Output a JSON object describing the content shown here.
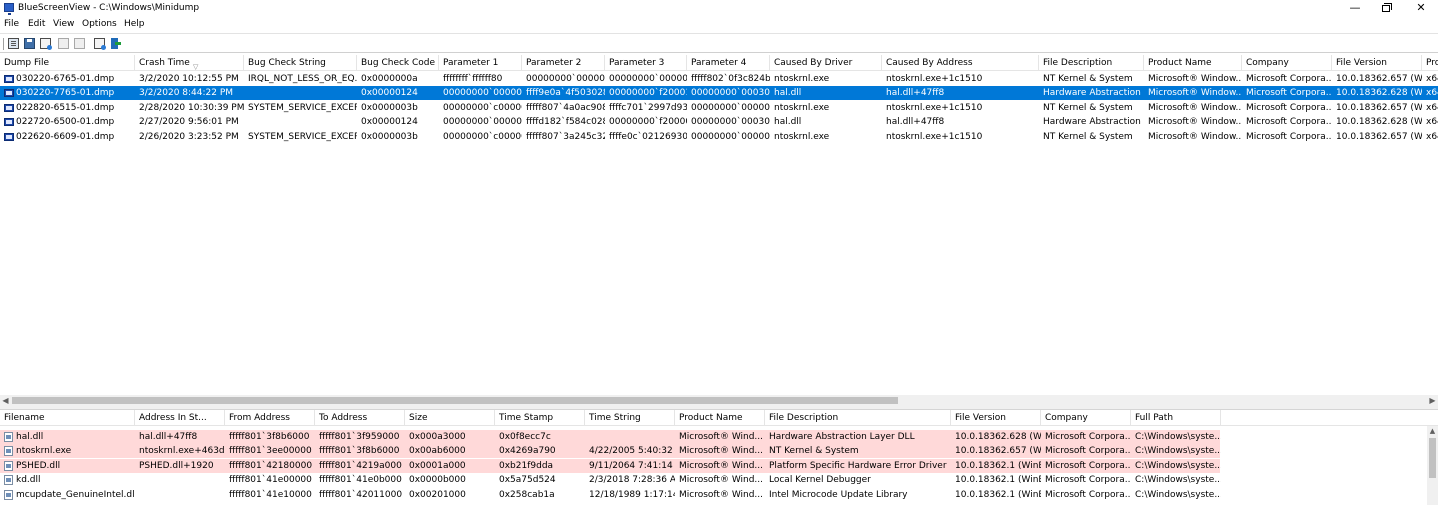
{
  "window": {
    "title": "BlueScreenView  -  C:\\Windows\\Minidump",
    "minimize_glyph": "—",
    "close_glyph": "✕"
  },
  "menu": [
    "File",
    "Edit",
    "View",
    "Options",
    "Help"
  ],
  "toolbar": {
    "icons": [
      "properties-icon",
      "save-icon",
      "html-report-icon",
      "copy-icon",
      "select-all-icon",
      "find-icon",
      "exit-icon"
    ]
  },
  "upper": {
    "sort_arrow": "▽",
    "columns": [
      "Dump File",
      "Crash Time",
      "Bug Check String",
      "Bug Check Code",
      "Parameter 1",
      "Parameter 2",
      "Parameter 3",
      "Parameter 4",
      "Caused By Driver",
      "Caused By Address",
      "File Description",
      "Product Name",
      "Company",
      "File Version",
      "Pro"
    ],
    "rows": [
      [
        "030220-6765-01.dmp",
        "3/2/2020 10:12:55 PM",
        "IRQL_NOT_LESS_OR_EQ...",
        "0x0000000a",
        "ffffffff`ffffff80",
        "00000000`000000...",
        "00000000`000000...",
        "fffff802`0f3c824b",
        "ntoskrnl.exe",
        "ntoskrnl.exe+1c1510",
        "NT Kernel & System",
        "Microsoft® Window...",
        "Microsoft Corpora...",
        "10.0.18362.657 (Wi...",
        "x64"
      ],
      [
        "030220-7765-01.dmp",
        "3/2/2020 8:44:22 PM",
        "",
        "0x00000124",
        "00000000`000000...",
        "ffff9e0a`4f503028",
        "00000000`f2000180",
        "00000000`000300...",
        "hal.dll",
        "hal.dll+47ff8",
        "Hardware Abstraction ...",
        "Microsoft® Window...",
        "Microsoft Corpora...",
        "10.0.18362.628 (Wi...",
        "x64"
      ],
      [
        "022820-6515-01.dmp",
        "2/28/2020 10:30:39 PM",
        "SYSTEM_SERVICE_EXCEP...",
        "0x0000003b",
        "00000000`c00000...",
        "fffff807`4a0ac908",
        "ffffc701`2997d930",
        "00000000`000000...",
        "ntoskrnl.exe",
        "ntoskrnl.exe+1c1510",
        "NT Kernel & System",
        "Microsoft® Window...",
        "Microsoft Corpora...",
        "10.0.18362.657 (Wi...",
        "x64"
      ],
      [
        "022720-6500-01.dmp",
        "2/27/2020 9:56:01 PM",
        "",
        "0x00000124",
        "00000000`000000...",
        "ffffd182`f584c028",
        "00000000`f20000c0",
        "00000000`000300...",
        "hal.dll",
        "hal.dll+47ff8",
        "Hardware Abstraction ...",
        "Microsoft® Window...",
        "Microsoft Corpora...",
        "10.0.18362.628 (Wi...",
        "x64"
      ],
      [
        "022620-6609-01.dmp",
        "2/26/2020 3:23:52 PM",
        "SYSTEM_SERVICE_EXCEP...",
        "0x0000003b",
        "00000000`c00000...",
        "fffff807`3a245c32",
        "ffffe0c`02126930",
        "00000000`000000...",
        "ntoskrnl.exe",
        "ntoskrnl.exe+1c1510",
        "NT Kernel & System",
        "Microsoft® Window...",
        "Microsoft Corpora...",
        "10.0.18362.657 (Wi...",
        "x64"
      ]
    ],
    "selected_row": 1
  },
  "scroll": {
    "left_arrow": "◀",
    "right_arrow": "▶",
    "up_arrow": "▲"
  },
  "lower": {
    "columns": [
      "Filename",
      "Address In St...",
      "From Address",
      "To Address",
      "Size",
      "Time Stamp",
      "Time String",
      "Product Name",
      "File Description",
      "File Version",
      "Company",
      "Full Path"
    ],
    "rows": [
      [
        "hal.dll",
        "hal.dll+47ff8",
        "fffff801`3f8b6000",
        "fffff801`3f959000",
        "0x000a3000",
        "0x0f8ecc7c",
        "",
        "Microsoft® Wind...",
        "Hardware Abstraction Layer DLL",
        "10.0.18362.628 (Wi...",
        "Microsoft Corpora...",
        "C:\\Windows\\syste..."
      ],
      [
        "ntoskrnl.exe",
        "ntoskrnl.exe+463d...",
        "fffff801`3ee00000",
        "fffff801`3f8b6000",
        "0x00ab6000",
        "0x4269a790",
        "4/22/2005 5:40:32 ...",
        "Microsoft® Wind...",
        "NT Kernel & System",
        "10.0.18362.657 (Wi...",
        "Microsoft Corpora...",
        "C:\\Windows\\syste..."
      ],
      [
        "PSHED.dll",
        "PSHED.dll+1920",
        "fffff801`42180000",
        "fffff801`4219a000",
        "0x0001a000",
        "0xb21f9dda",
        "9/11/2064 7:41:14 ...",
        "Microsoft® Wind...",
        "Platform Specific Hardware Error Driver",
        "10.0.18362.1 (WinB...",
        "Microsoft Corpora...",
        "C:\\Windows\\syste..."
      ],
      [
        "kd.dll",
        "",
        "fffff801`41e00000",
        "fffff801`41e0b000",
        "0x0000b000",
        "0x5a75d524",
        "2/3/2018 7:28:36 AM",
        "Microsoft® Wind...",
        "Local Kernel Debugger",
        "10.0.18362.1 (WinB...",
        "Microsoft Corpora...",
        "C:\\Windows\\syste..."
      ],
      [
        "mcupdate_GenuineIntel.dll",
        "",
        "fffff801`41e10000",
        "fffff801`42011000",
        "0x00201000",
        "0x258cab1a",
        "12/18/1989 1:17:14...",
        "Microsoft® Wind...",
        "Intel Microcode Update Library",
        "10.0.18362.1 (WinB...",
        "Microsoft Corpora...",
        "C:\\Windows\\syste..."
      ]
    ],
    "highlighted_rows": [
      0,
      1,
      2
    ]
  },
  "colors": {
    "selection": "#0078d7",
    "highlight": "#ffd9d9"
  }
}
